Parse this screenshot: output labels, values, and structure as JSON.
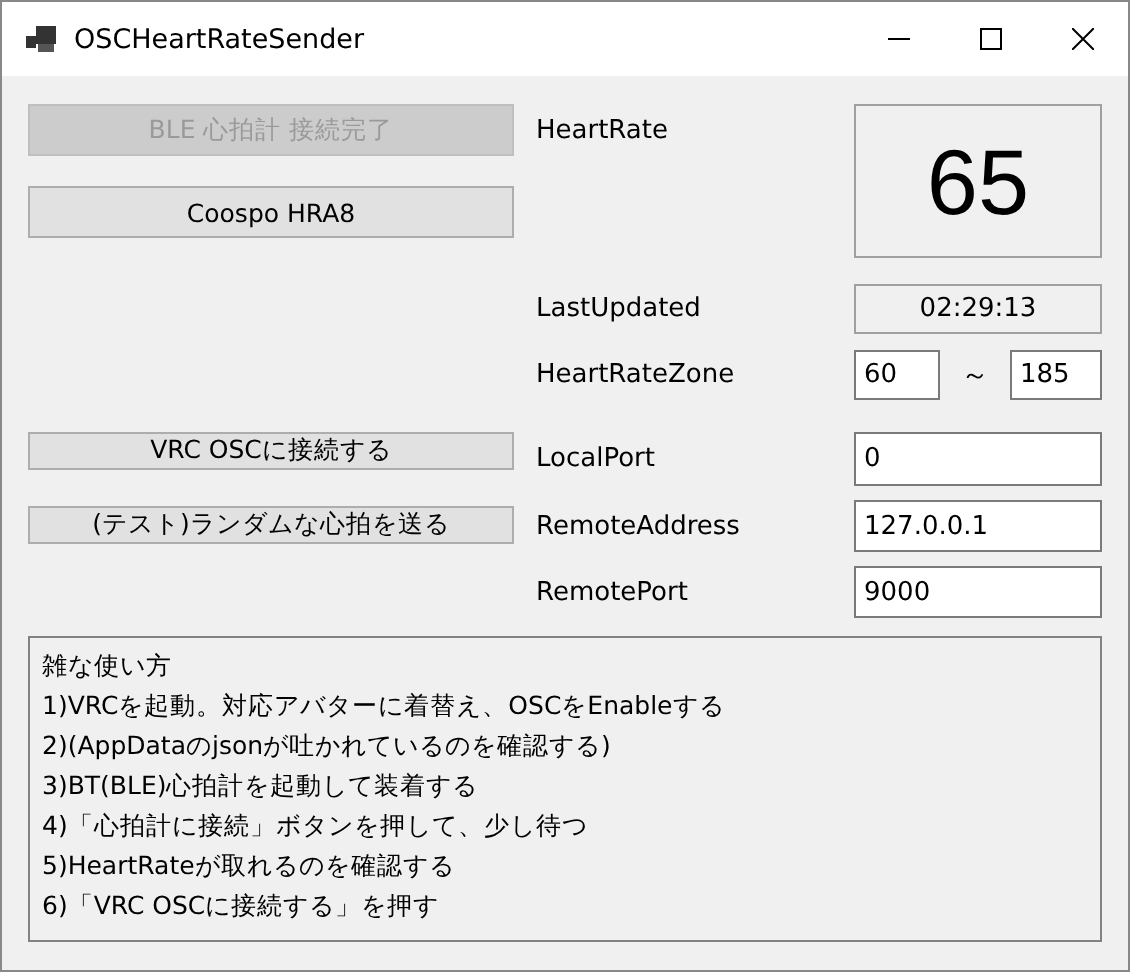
{
  "window": {
    "title": "OSCHeartRateSender"
  },
  "buttons": [
    {
      "label": "BLE 心拍計 接続完了",
      "disabled": true
    },
    {
      "label": "Coospo HRA8",
      "disabled": false
    },
    {
      "label": "VRC OSCに接続する",
      "disabled": false
    },
    {
      "label": "(テスト)ランダムな心拍を送る",
      "disabled": false
    }
  ],
  "heart_rate": {
    "label": "HeartRate",
    "value": "65"
  },
  "last_updated": {
    "label": "LastUpdated",
    "value": "02:29:13"
  },
  "heart_rate_zone": {
    "label": "HeartRateZone",
    "min": "60",
    "separator": "～",
    "max": "185"
  },
  "local_port": {
    "label": "LocalPort",
    "value": "0"
  },
  "remote_address": {
    "label": "RemoteAddress",
    "value": "127.0.0.1"
  },
  "remote_port": {
    "label": "RemotePort",
    "value": "9000"
  },
  "instructions": [
    "雑な使い方",
    "1)VRCを起動。対応アバターに着替え、OSCをEnableする",
    "2)(AppDataのjsonが吐かれているのを確認する)",
    "3)BT(BLE)心拍計を起動して装着する",
    "4)「心拍計に接続」ボタンを押して、少し待つ",
    "5)HeartRateが取れるのを確認する",
    "6)「VRC OSCに接続する」を押す"
  ]
}
